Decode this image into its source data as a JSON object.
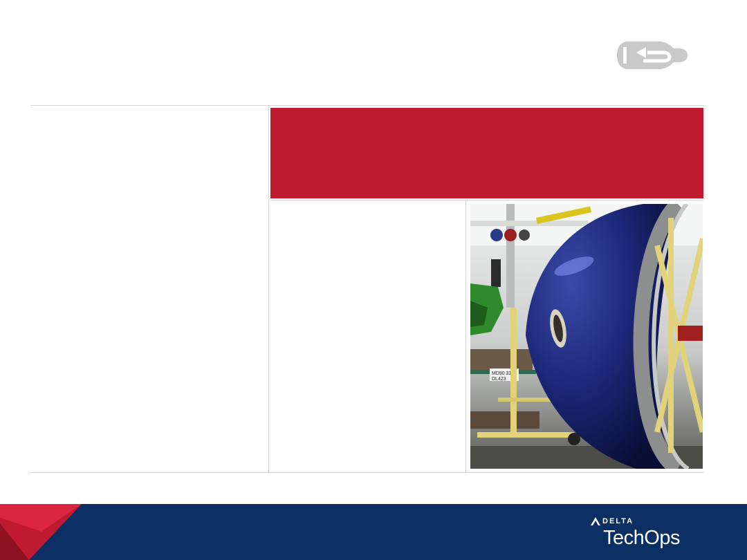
{
  "slide": {
    "back_icon": "back-arrow-icon",
    "banner_color": "#c01a31",
    "footer_color": "#0b2f63"
  },
  "photo": {
    "tag_line1": "MD90 31R",
    "tag_line2": "DL423"
  },
  "logo": {
    "top": "DELTA",
    "main": "TechOps",
    "icon": "delta-widget-icon"
  }
}
